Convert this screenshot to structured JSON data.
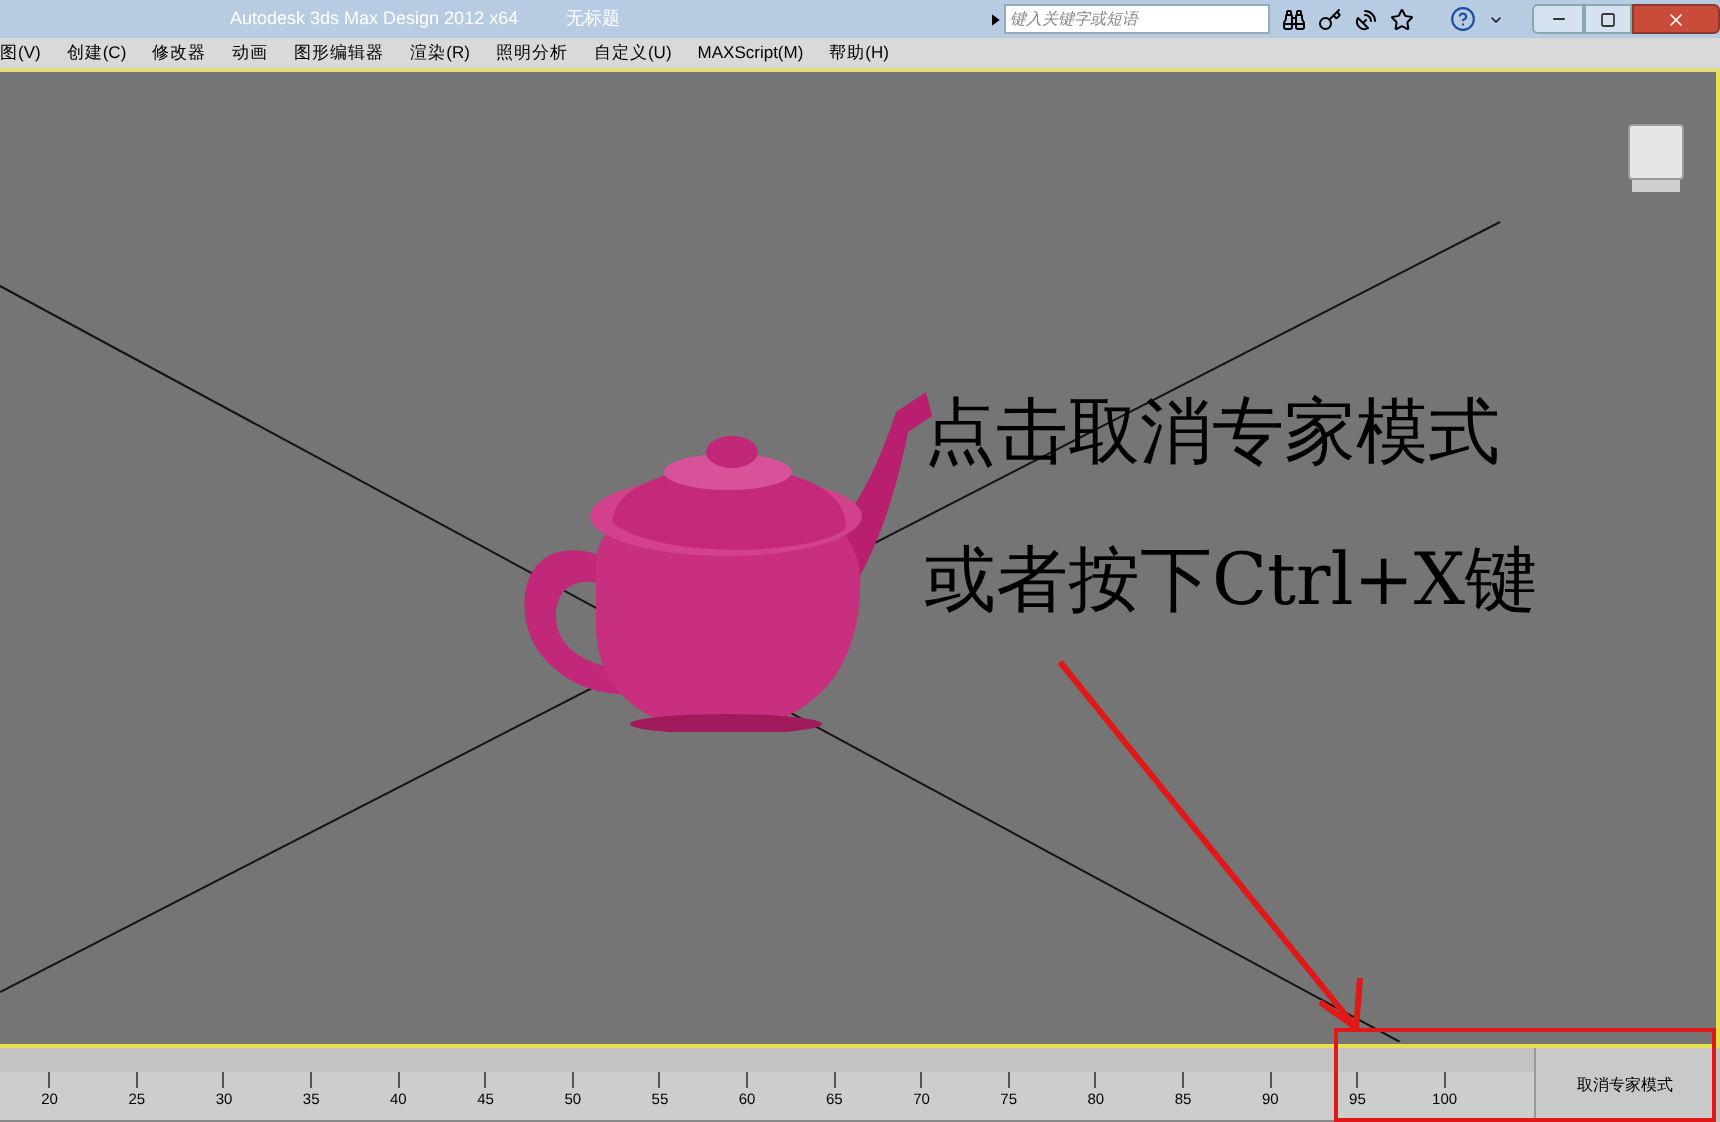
{
  "title_bar": {
    "app_title": "Autodesk 3ds Max Design 2012 x64",
    "document_title": "无标题",
    "search": {
      "placeholder": "键入关键字或短语"
    }
  },
  "menu_bar": [
    "图(V)",
    "创建(C)",
    "修改器",
    "动画",
    "图形编辑器",
    "渲染(R)",
    "照明分析",
    "自定义(U)",
    "MAXScript(M)",
    "帮助(H)"
  ],
  "annotation": [
    "点击取消专家模式",
    "或者按下Ctrl+X键"
  ],
  "timeline": {
    "ticks": [
      "20",
      "25",
      "30",
      "35",
      "40",
      "45",
      "50",
      "55",
      "60",
      "65",
      "70",
      "75",
      "80",
      "85",
      "90",
      "95",
      "100"
    ]
  },
  "status_bar": {
    "button": "取消专家模式"
  }
}
